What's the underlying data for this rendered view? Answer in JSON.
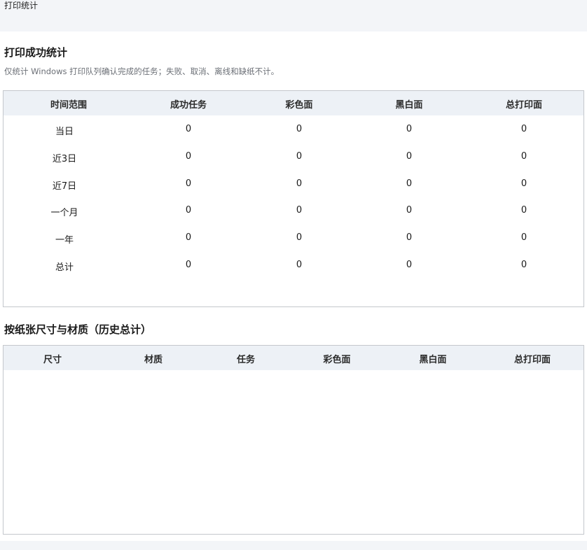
{
  "window": {
    "title": "打印统计"
  },
  "success_section": {
    "title": "打印成功统计",
    "description": "仅统计 Windows 打印队列确认完成的任务；失败、取消、离线和缺纸不计。",
    "columns": [
      "时间范围",
      "成功任务",
      "彩色面",
      "黑白面",
      "总打印面"
    ],
    "rows": [
      [
        "当日",
        "0",
        "0",
        "0",
        "0"
      ],
      [
        "近3日",
        "0",
        "0",
        "0",
        "0"
      ],
      [
        "近7日",
        "0",
        "0",
        "0",
        "0"
      ],
      [
        "一个月",
        "0",
        "0",
        "0",
        "0"
      ],
      [
        "一年",
        "0",
        "0",
        "0",
        "0"
      ],
      [
        "总计",
        "0",
        "0",
        "0",
        "0"
      ]
    ]
  },
  "paper_section": {
    "title": "按纸张尺寸与材质（历史总计）",
    "columns": [
      "尺寸",
      "材质",
      "任务",
      "彩色面",
      "黑白面",
      "总打印面"
    ],
    "rows": []
  }
}
